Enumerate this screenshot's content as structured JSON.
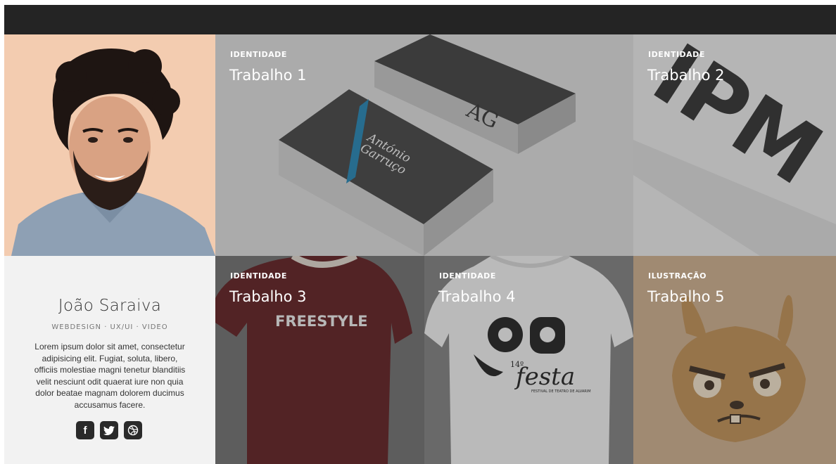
{
  "profile": {
    "name": "João Saraiva",
    "skills": "WEBDESIGN  ·  UX/UI  ·  VIDEO",
    "description": "Lorem ipsum dolor sit amet, consectetur adipisicing elit. Fugiat, soluta, libero, officiis molestiae magni tenetur blanditiis velit nesciunt odit quaerat iure non quia dolor beatae magnam dolorem ducimus accusamus facere.",
    "social": [
      {
        "label": "f",
        "icon": "facebook-icon"
      },
      {
        "label": "t",
        "icon": "twitter-icon"
      },
      {
        "label": "dribbble",
        "icon": "dribbble-icon"
      }
    ]
  },
  "works": [
    {
      "category": "IDENTIDADE",
      "title": "Trabalho 1",
      "card_text_1": "António",
      "card_text_2": "Garruço",
      "monogram": "AG"
    },
    {
      "category": "IDENTIDADE",
      "title": "Trabalho 2",
      "letters": "IPM"
    },
    {
      "category": "IDENTIDADE",
      "title": "Trabalho 3",
      "shirt_text": "FREESTYLE"
    },
    {
      "category": "IDENTIDADE",
      "title": "Trabalho 4",
      "shirt_text": "festa",
      "shirt_sub": "14º",
      "shirt_caption": "FESTIVAL DE TEATRO DE ALVARIM"
    },
    {
      "category": "ILUSTRAÇÃO",
      "title": "Trabalho 5"
    }
  ],
  "colors": {
    "topbar": "#242424",
    "bio_bg": "#f2f2f2",
    "accent_blue": "#1f7fae",
    "shirt_red": "#5a1a1c"
  }
}
